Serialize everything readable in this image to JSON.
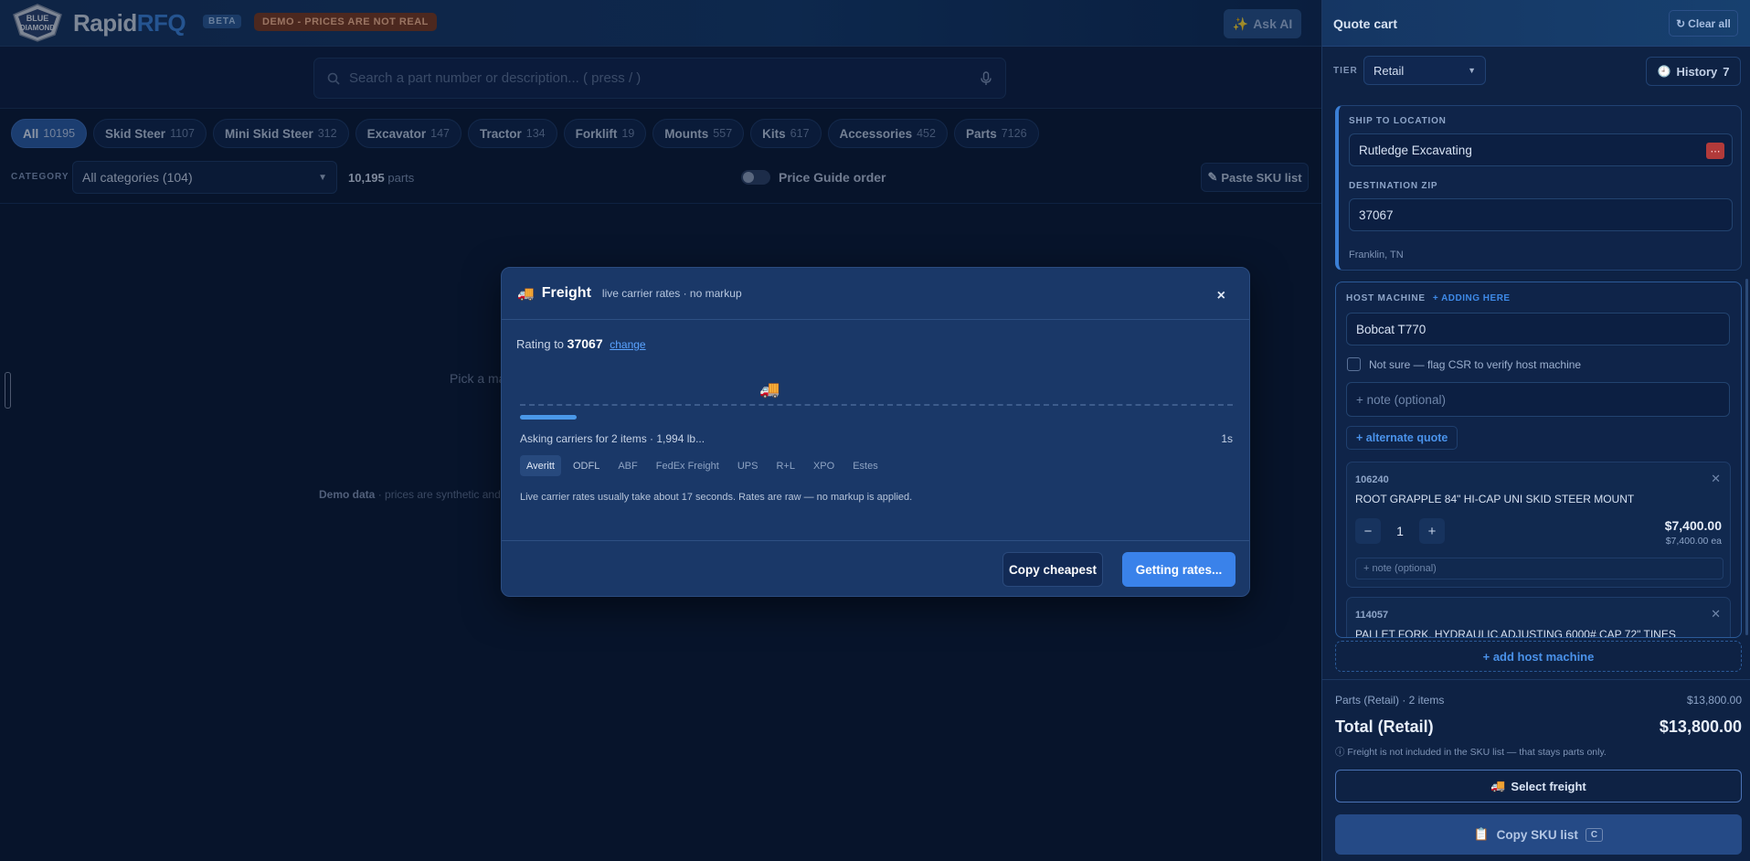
{
  "header": {
    "brand_part1": "Rapid",
    "brand_part2": "RFQ",
    "beta_badge": "BETA",
    "demo_badge": "DEMO - PRICES ARE NOT REAL",
    "ask_ai_label": "Ask AI",
    "logo_text": "BLUE DIAMOND"
  },
  "search": {
    "placeholder": "Search a part number or description...   ( press / )"
  },
  "chips": [
    {
      "label": "All",
      "count": "10195",
      "active": true
    },
    {
      "label": "Skid Steer",
      "count": "1107"
    },
    {
      "label": "Mini Skid Steer",
      "count": "312"
    },
    {
      "label": "Excavator",
      "count": "147"
    },
    {
      "label": "Tractor",
      "count": "134"
    },
    {
      "label": "Forklift",
      "count": "19"
    },
    {
      "label": "Mounts",
      "count": "557"
    },
    {
      "label": "Kits",
      "count": "617"
    },
    {
      "label": "Accessories",
      "count": "452"
    },
    {
      "label": "Parts",
      "count": "7126"
    }
  ],
  "filters": {
    "category_label": "CATEGORY",
    "category_value": "All categories (104)",
    "parts_count": "10,195",
    "parts_suffix": "parts",
    "price_guide_label": "Price Guide order",
    "paste_sku_label": "Paste SKU list"
  },
  "main": {
    "empty_text": "Pick a ma",
    "demo_data_bold": "Demo data",
    "demo_data_text": " · prices are synthetic and d"
  },
  "modal": {
    "title": "Freight",
    "subtitle": "live carrier rates · no markup",
    "close": "×",
    "rating_prefix": "Rating to",
    "zip": "37067",
    "change_label": "change",
    "asking_text": "Asking carriers for 2 items · 1,994 lb...",
    "elapsed": "1s",
    "carriers": [
      "Averitt",
      "ODFL",
      "ABF",
      "FedEx Freight",
      "UPS",
      "R+L",
      "XPO",
      "Estes"
    ],
    "note": "Live carrier rates usually take about 17 seconds. Rates are raw — no markup is applied.",
    "copy_cheapest_label": "Copy cheapest",
    "getting_rates_label": "Getting rates...",
    "progress": 0.07
  },
  "cart": {
    "title": "Quote cart",
    "clear_all_label": "Clear all",
    "tier_label": "TIER",
    "tier_value": "Retail",
    "history_label": "History",
    "history_count": "7",
    "ship_to_label": "SHIP TO LOCATION",
    "ship_to_value": "Rutledge Excavating",
    "dest_zip_label": "DESTINATION ZIP",
    "dest_zip_value": "37067",
    "city": "Franklin, TN",
    "host_label": "HOST MACHINE",
    "adding_here": "+ ADDING HERE",
    "host_value": "Bobcat T770",
    "not_sure_label": "Not sure — flag CSR to verify host machine",
    "note_placeholder": "+ note (optional)",
    "alt_quote_label": "+ alternate quote",
    "items": [
      {
        "sku": "106240",
        "desc": "ROOT GRAPPLE 84\" HI-CAP UNI SKID STEER MOUNT",
        "qty": "1",
        "price": "$7,400.00",
        "each": "$7,400.00 ea",
        "note": "+ note (optional)"
      },
      {
        "sku": "114057",
        "desc": "PALLET FORK, HYDRAULIC ADJUSTING 6000# CAP 72\" TINES"
      }
    ],
    "add_host_label": "+ add host machine",
    "parts_summary_label": "Parts (Retail) · 2 items",
    "parts_summary_value": "$13,800.00",
    "total_label": "Total (Retail)",
    "total_value": "$13,800.00",
    "freight_note": "ⓘ Freight is not included in the SKU list — that stays parts only.",
    "select_freight_label": "Select freight",
    "copy_sku_label": "Copy SKU list",
    "copy_sku_kbd": "C"
  }
}
